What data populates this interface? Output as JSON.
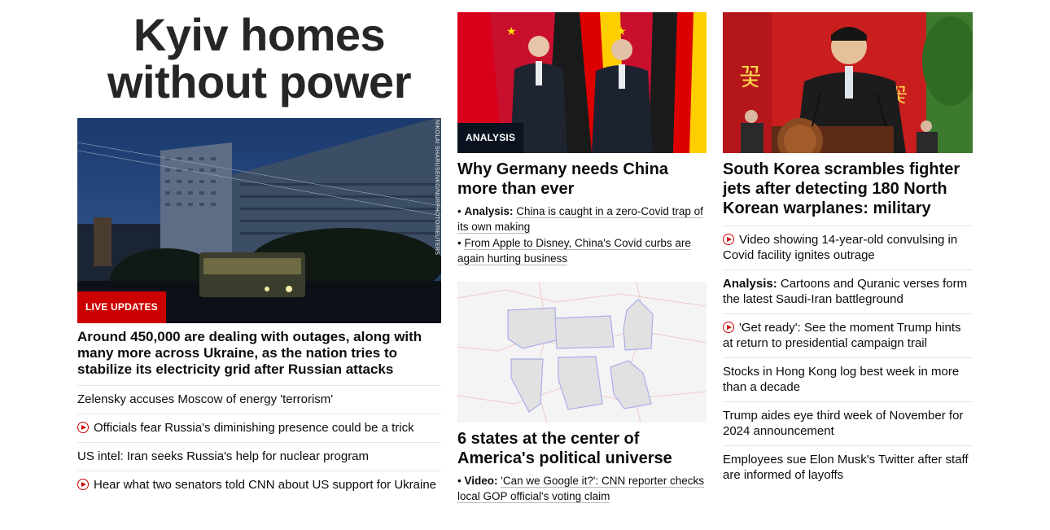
{
  "col1": {
    "hero_title": "Kyiv homes without power",
    "badge": "LIVE UPDATES",
    "credit": "NIKOLAI SHARUSENKO/NURPHOTO/REUTERS",
    "headline": "Around 450,000 are dealing with outages, along with many more across Ukraine, as the nation tries to stabilize its electricity grid after Russian attacks",
    "links": [
      {
        "text": "Zelensky accuses Moscow of energy 'terrorism'",
        "video": false
      },
      {
        "text": "Officials fear Russia's diminishing presence could be a trick",
        "video": true
      },
      {
        "text": "US intel: Iran seeks Russia's help for nuclear program",
        "video": false
      },
      {
        "text": "Hear what two senators told CNN about US support for Ukraine",
        "video": true
      }
    ]
  },
  "col2": {
    "badge": "ANALYSIS",
    "story1": {
      "headline": "Why Germany needs China more than ever",
      "bullets": [
        {
          "prefix": "Analysis:",
          "text": "China is caught in a zero-Covid trap of its own making"
        },
        {
          "prefix": "",
          "text": "From Apple to Disney, China's Covid curbs are again hurting business"
        }
      ]
    },
    "story2": {
      "headline": "6 states at the center of America's political universe",
      "bullets": [
        {
          "prefix": "Video:",
          "text": "'Can we Google it?': CNN reporter checks local GOP official's voting claim"
        }
      ]
    }
  },
  "col3": {
    "headline": "South Korea scrambles fighter jets after detecting 180 North Korean warplanes: military",
    "links": [
      {
        "prefix": "",
        "text": "Video showing 14-year-old convulsing in Covid facility ignites outrage",
        "video": true
      },
      {
        "prefix": "Analysis:",
        "text": "Cartoons and Quranic verses form the latest Saudi-Iran battleground",
        "video": false
      },
      {
        "prefix": "",
        "text": "'Get ready': See the moment Trump hints at return to presidential campaign trail",
        "video": true
      },
      {
        "prefix": "",
        "text": "Stocks in Hong Kong log best week in more than a decade",
        "video": false
      },
      {
        "prefix": "",
        "text": "Trump aides eye third week of November for 2024 announcement",
        "video": false
      },
      {
        "prefix": "",
        "text": "Employees sue Elon Musk's Twitter after staff are informed of layoffs",
        "video": false
      }
    ]
  },
  "colors": {
    "accent_red": "#cc0000",
    "analysis_badge": "#0c1320",
    "divider": "#e6e6e6"
  }
}
